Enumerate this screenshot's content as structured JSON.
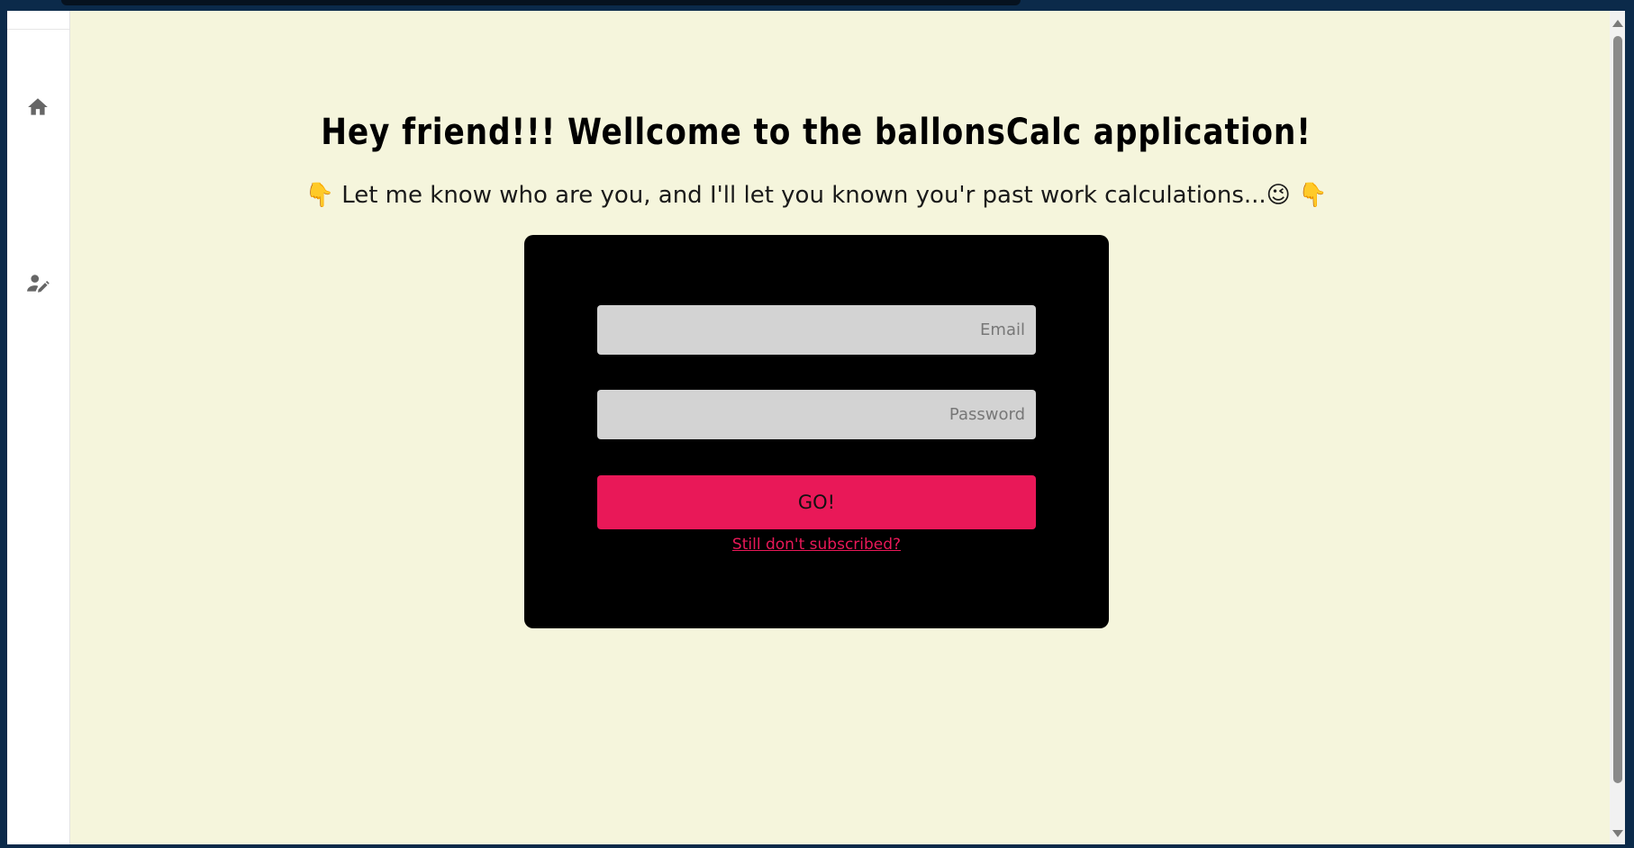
{
  "sidebar": {
    "items": [
      {
        "icon": "home-icon"
      },
      {
        "icon": "user-edit-icon"
      }
    ]
  },
  "main": {
    "title": "Hey friend!!! Wellcome to the ballonsCalc application!",
    "subtitle": "👇 Let me know who are you, and I'll let you known you'r past work calculations...😉 👇"
  },
  "login": {
    "email_placeholder": "Email",
    "password_placeholder": "Password",
    "submit_label": "GO!",
    "signup_link": "Still don't subscribed?"
  },
  "colors": {
    "background": "#f5f5dc",
    "card": "#000000",
    "accent": "#e91858",
    "field": "#d3d3d3"
  }
}
